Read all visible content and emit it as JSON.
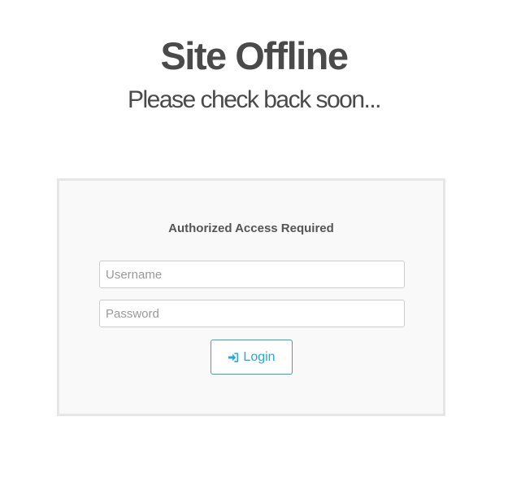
{
  "header": {
    "title": "Site Offline",
    "subtitle": "Please check back soon..."
  },
  "login": {
    "heading": "Authorized Access Required",
    "username_placeholder": "Username",
    "password_placeholder": "Password",
    "button_label": "Login",
    "button_icon": "sign-in-icon"
  },
  "colors": {
    "accent": "#26a8d8",
    "panel_background": "#f9f9f9",
    "panel_border": "#e6e6e6",
    "text": "#4a4a4a"
  }
}
